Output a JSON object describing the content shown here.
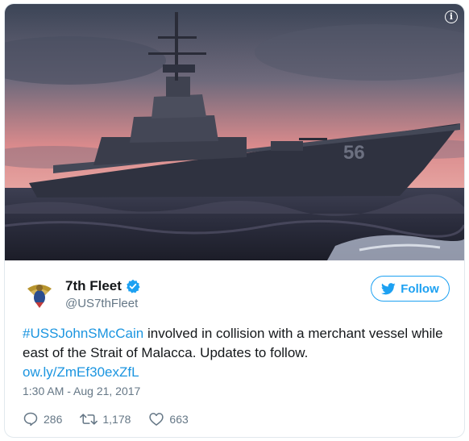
{
  "tweet": {
    "account": {
      "name": "7th Fleet",
      "handle": "@US7thFleet",
      "verified": true
    },
    "follow_label": "Follow",
    "text": {
      "hashtag": "#USSJohnSMcCain",
      "body_line": " involved in collision with a merchant vessel while east of the Strait of Malacca. Updates to follow.",
      "link": "ow.ly/ZmEf30exZfL"
    },
    "timestamp": "1:30 AM - Aug 21, 2017",
    "stats": {
      "replies": "286",
      "retweets": "1,178",
      "likes": "663"
    },
    "media": {
      "hull_number": "56"
    }
  },
  "colors": {
    "accent": "#1da1f2",
    "link": "#1b95e0",
    "text": "#14171a",
    "muted": "#657786",
    "border": "#e1e8ed"
  },
  "icons": [
    "info-icon",
    "verified-badge-icon",
    "twitter-bird-icon",
    "reply-icon",
    "retweet-icon",
    "like-icon"
  ]
}
